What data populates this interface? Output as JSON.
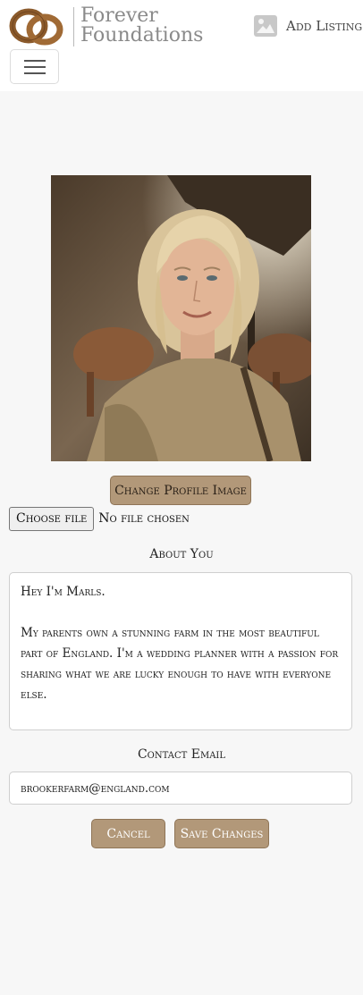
{
  "brand": {
    "line1": "Forever",
    "line2": "Foundations",
    "logo_icon": "interlocked-rings-logo",
    "accent_color": "#8b5a2b"
  },
  "nav": {
    "add_listing_label": "Add Listing",
    "add_listing_icon": "image-icon",
    "menu_icon": "hamburger-icon"
  },
  "profile": {
    "image_alt": "profile photo",
    "change_image_label": "Change Profile Image",
    "file_button_label": "Choose file",
    "file_status": "No file chosen"
  },
  "about": {
    "label": "About You",
    "value": "Hey I'm Marls.\n\nMy parents own a stunning farm in the most beautiful part of England. I'm a wedding planner with a passion for sharing what we are lucky enough to have with everyone else."
  },
  "contact": {
    "label": "Contact Email",
    "value": "brookerfarm@england.com"
  },
  "actions": {
    "cancel_label": "Cancel",
    "save_label": "Save Changes"
  },
  "colors": {
    "button_bg": "#b29879",
    "page_bg": "#f7f7f7"
  }
}
